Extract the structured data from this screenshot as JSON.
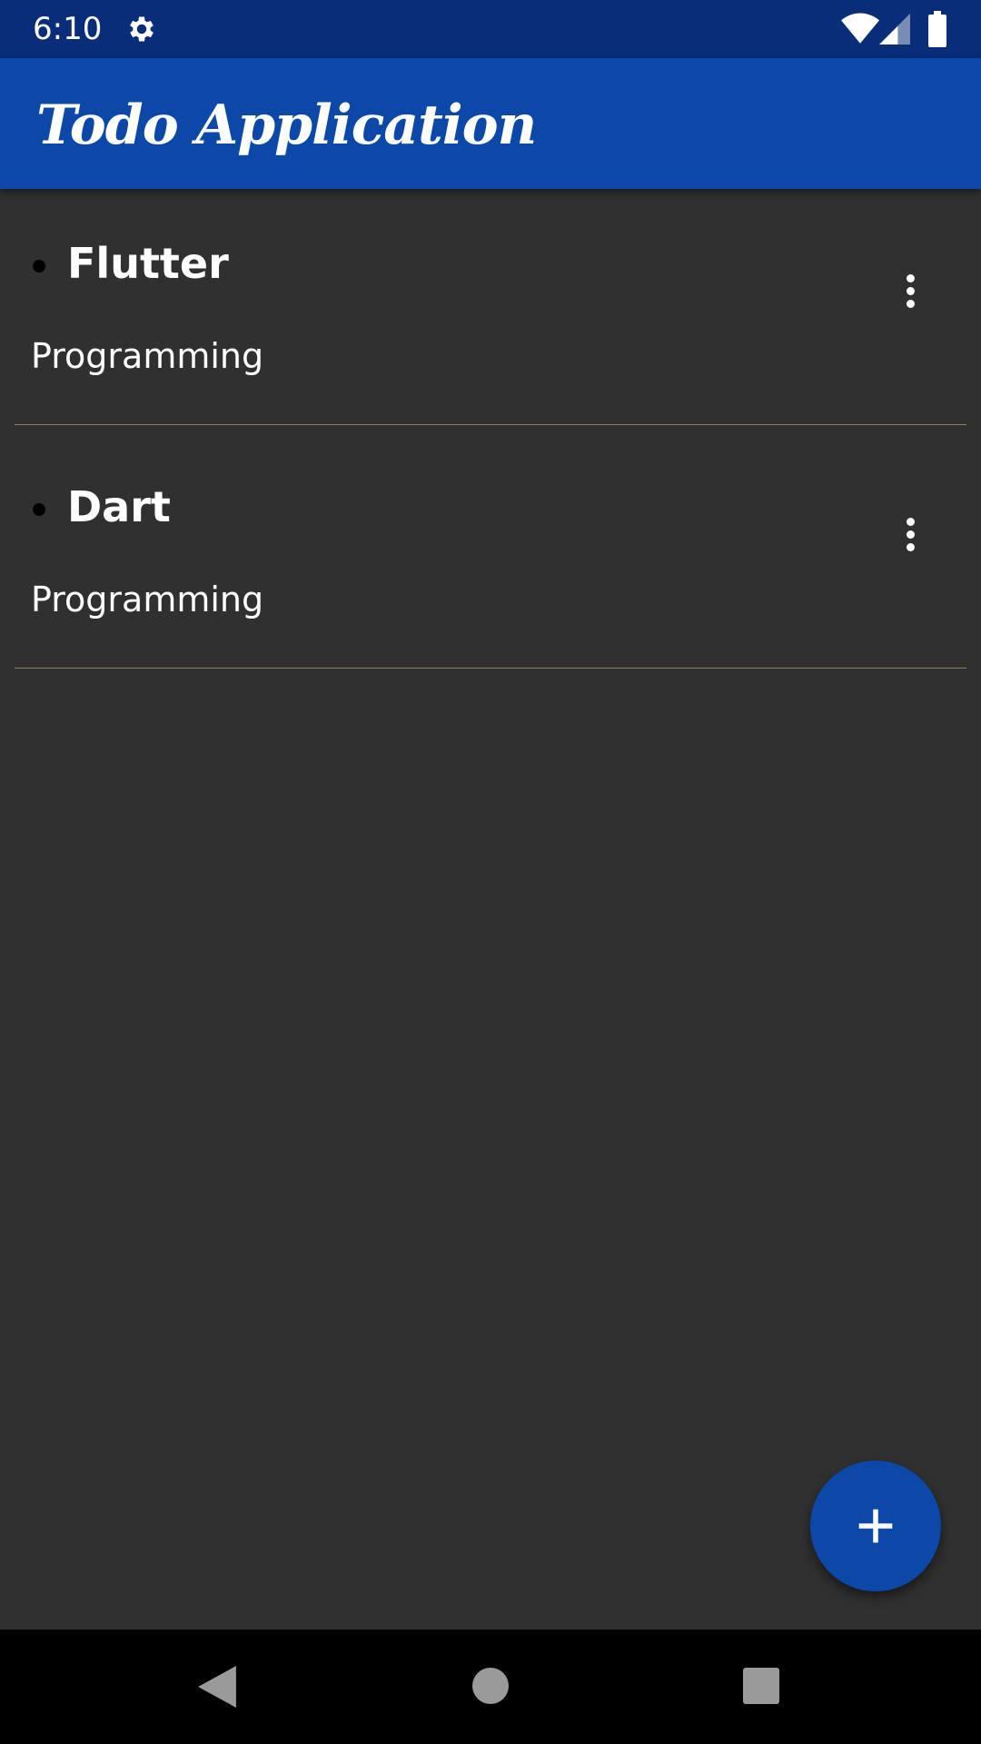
{
  "status_bar": {
    "time": "6:10",
    "icons": [
      "gear-icon",
      "wifi-icon",
      "signal-icon",
      "battery-icon"
    ]
  },
  "app_bar": {
    "title": "Todo Application"
  },
  "todos": [
    {
      "title": "Flutter",
      "category": "Programming"
    },
    {
      "title": "Dart",
      "category": "Programming"
    }
  ],
  "fab": {
    "icon": "plus-icon"
  },
  "nav_bar": {
    "icons": [
      "back-icon",
      "home-icon",
      "recents-icon"
    ]
  },
  "colors": {
    "primary": "#0b48a8",
    "status_bar": "#0a2d7a",
    "background": "#303030",
    "divider": "#8a7f5e",
    "text": "#ffffff"
  }
}
